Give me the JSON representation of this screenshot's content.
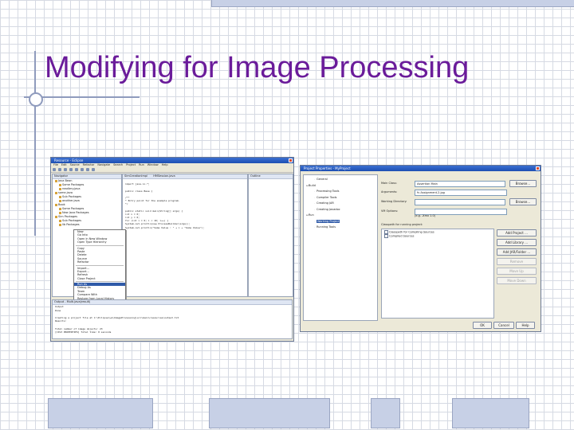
{
  "slide": {
    "title": "Modifying for Image Processing"
  },
  "eclipse": {
    "window_title": "Resource - Eclipse",
    "menu": [
      "File",
      "Edit",
      "Source",
      "Refactor",
      "Navigate",
      "Search",
      "Project",
      "Run",
      "Window",
      "Help"
    ],
    "navigator_tab": "Navigator",
    "navigator_items": [
      "Java Bean",
      "Some Packages",
      "readlery.java",
      "some.java",
      "Sub Packages",
      "another.java",
      "Book",
      "Some Packages",
      "New Java Packages",
      "Sim Packages",
      "Sub Packages",
      "lib Packages"
    ],
    "editor_tabs": [
      "SimCreationImpl",
      "HMSession.java"
    ],
    "outline_tab": "Outline",
    "code_lines": [
      "",
      "import java.io.*;",
      "",
      "public class Base {",
      "",
      "  /**",
      "   * Entry point for the example program.",
      "   */",
      "",
      "  public static void main(String[] args) {",
      "    int x = 0;",
      "    int y = 0;",
      "    for (int i = 0; i < 10; i++) {",
      "      System.out.println(new ProcessBuilder(args));",
      "      System.out.println(\"Some Value : \" + i + \"Some Value\");",
      "    }",
      "  }",
      "}"
    ],
    "context_menu": [
      "New",
      "Go Into",
      "Open in New Window",
      "Open Type Hierarchy",
      "Copy",
      "Paste",
      "Delete",
      "Source",
      "Refactor",
      "Import...",
      "Export...",
      "Refresh",
      "Close Project",
      "Run As",
      "Debug As",
      "Team",
      "Compare With",
      "Restore from Local History",
      "Properties"
    ],
    "context_selected": "Run As",
    "console_tab": "Output - Multi.java(result)",
    "console_lines": [
      "Output",
      "Done",
      "",
      "Creating a project file at C:\\Eclipse\\ws\\ImageProcessing\\src\\main\\resources\\output.txt",
      "Results:",
      "",
      "Total number of image objects: 23",
      "[CIS3 PROPERTIES] Total time: 0 seconds"
    ]
  },
  "dialog": {
    "title": "Project Properties - MyProject",
    "tree": [
      {
        "label": "General",
        "level": 1
      },
      {
        "label": "Build",
        "level": 0
      },
      {
        "label": "Processing Tools",
        "level": 1
      },
      {
        "label": "Compiler Tools",
        "level": 1
      },
      {
        "label": "Creating JAR",
        "level": 1
      },
      {
        "label": "Creating Javadoc",
        "level": 1
      },
      {
        "label": "Run",
        "level": 0
      },
      {
        "label": "Working Project",
        "level": 1
      },
      {
        "label": "Running Tools",
        "level": 1
      }
    ],
    "tree_selected": "Working Project",
    "fields": [
      {
        "label": "Main Class:",
        "value": "Assertion Main",
        "button": "Browse..."
      },
      {
        "label": "Arguments:",
        "value": "fv Assignment.2.jpg",
        "button": ""
      },
      {
        "label": "Working Directory:",
        "value": "",
        "button": "Browse..."
      },
      {
        "label": "VM Options:",
        "value": "",
        "button": ""
      }
    ],
    "vm_hint": "(e.g. -Xmx 1.0)",
    "classpath_label": "Classpath for running project:",
    "classpath_items": [
      "Classpath for Compiling Sources",
      "Compiled Sources"
    ],
    "side_buttons": [
      {
        "label": "Add Project ...",
        "enabled": true
      },
      {
        "label": "Add Library ...",
        "enabled": true
      },
      {
        "label": "Add JAR/Folder ...",
        "enabled": true
      },
      {
        "label": "Remove",
        "enabled": false
      },
      {
        "label": "Move Up",
        "enabled": false
      },
      {
        "label": "Move Down",
        "enabled": false
      }
    ],
    "ok": "OK",
    "cancel": "Cancel",
    "help": "Help"
  }
}
